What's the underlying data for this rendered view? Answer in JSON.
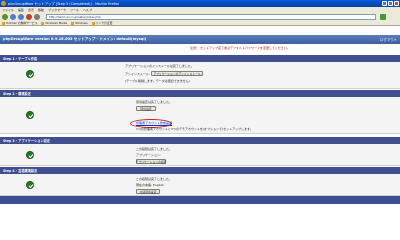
{
  "window": {
    "title": "phpGroupWare セットアップ [Step 3 (Completed)] - Mozilla Firefox"
  },
  "menubar": [
    "ファイル",
    "編集",
    "表示",
    "移動",
    "ブックマーク",
    "ツール",
    "ヘルプ"
  ],
  "url": "http://demo.xx.co.jp/setup/index.php",
  "bookmarks": [
    "Hotmail の無料サービス",
    "Windows Media",
    "Windows",
    "リンクの変更"
  ],
  "page_header": {
    "title": "phpGroupWare version 0.9.16.003 セットアップ - ドメイン: default(mysql)",
    "logout": "ログアウト"
  },
  "warning": "注意！ セットアップ完了後はデフォルトパスワードを変更してください。",
  "steps": [
    {
      "header": "Step 1 - テーブル作成",
      "lines": [
        "アプリケーションのインストールは完了しました。",
        "アンインストール:",
        "(テーブル削除します。データは復旧できません)"
      ],
      "button": "アプリケーションのアンインストール"
    },
    {
      "header": "Step 2 - 環境設定",
      "lines": [
        "環境設定は完了しました。",
        "1つの管理者アカウントと3つのデモアカウントを(オプションで)セットアップします。"
      ],
      "button": "環境設定",
      "link": "管理者アカウント作成画面"
    },
    {
      "header": "Step 3 - アプリケーション設定",
      "lines": [
        "この段階は完了しました。",
        "アプリケーション:"
      ],
      "button": "アプリケーションの設定"
    },
    {
      "header": "Step 4 - 言語環境設定",
      "lines": [
        "この段階は完了しました。",
        "現在の言語: English"
      ],
      "button": "言語環境設定"
    }
  ],
  "colors": {
    "title_bar": "#0a5bd8",
    "page_header": "#3d5f9e",
    "step_header": "#3e4e8e",
    "check": "#2a7a2a",
    "highlight_oval": "#d02020"
  },
  "icons": {
    "check": "check-icon",
    "browser": "firefox-icon"
  }
}
